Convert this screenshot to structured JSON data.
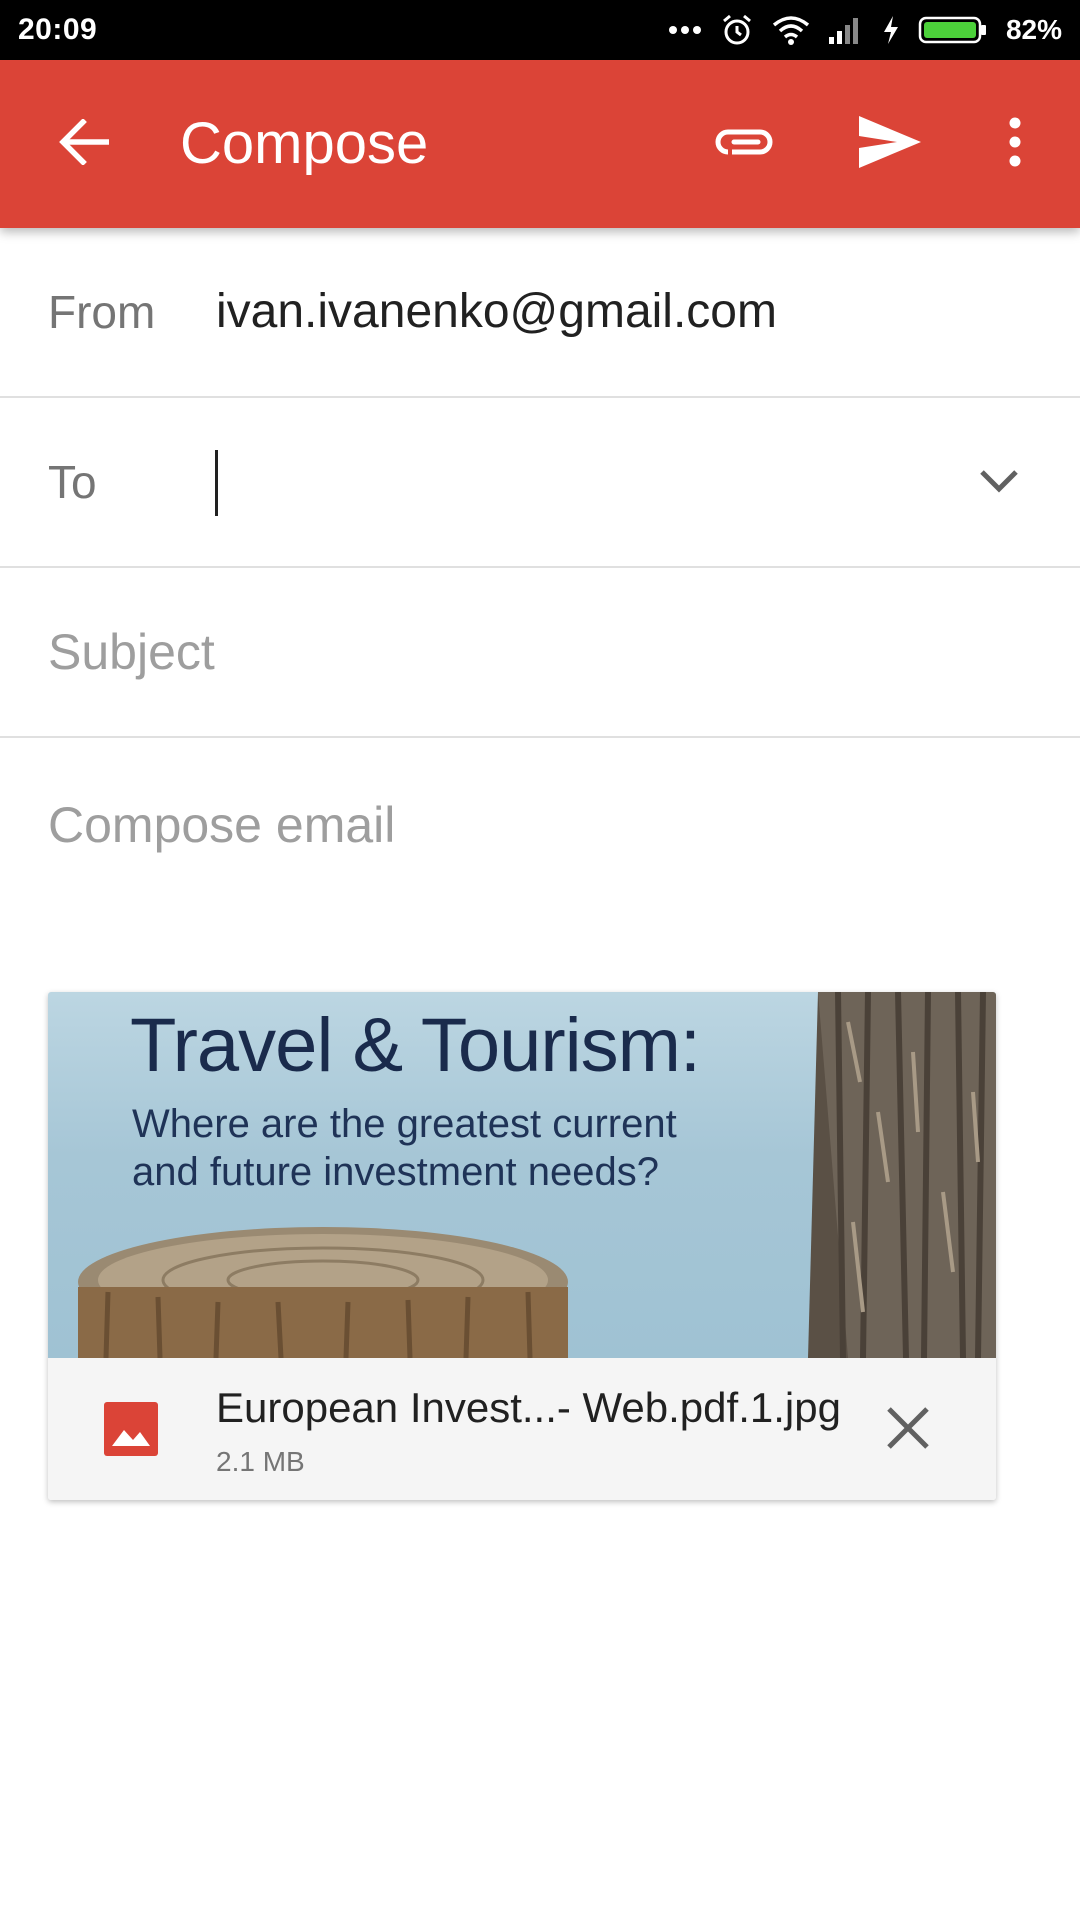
{
  "status_bar": {
    "time": "20:09",
    "battery_percent": "82%",
    "icons": [
      "more-dots-icon",
      "alarm-icon",
      "wifi-icon",
      "signal-icon",
      "charging-icon",
      "battery-icon"
    ]
  },
  "app_bar": {
    "title": "Compose",
    "background_color": "#db4437",
    "icons": [
      "back-arrow-icon",
      "paperclip-icon",
      "send-icon",
      "overflow-menu-icon"
    ]
  },
  "fields": {
    "from_label": "From",
    "from_value": "ivan.ivanenko@gmail.com",
    "to_label": "To",
    "to_value": "",
    "subject_placeholder": "Subject",
    "body_placeholder": "Compose email"
  },
  "attachment": {
    "preview_title": "Travel & Tourism:",
    "preview_subtitle": "Where are the greatest current and future investment needs?",
    "file_name": "European Invest...- Web.pdf.1.jpg",
    "file_size": "2.1 MB",
    "icon": "image-file-icon",
    "icon_color": "#db4437"
  }
}
